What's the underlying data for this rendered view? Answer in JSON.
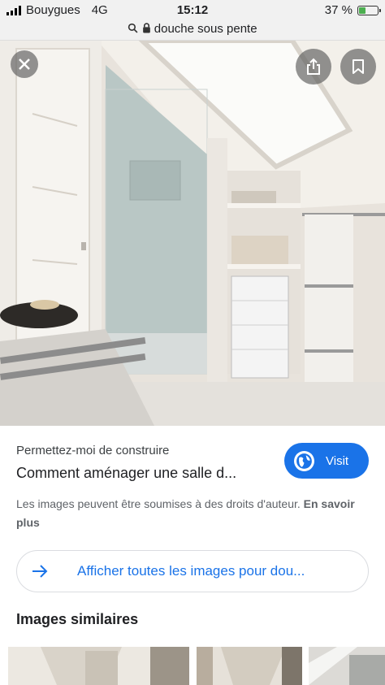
{
  "status_bar": {
    "carrier": "Bouygues",
    "network": "4G",
    "time": "15:12",
    "battery": "37 %",
    "battery_level": 0.37
  },
  "url_bar": {
    "query": "douche sous pente"
  },
  "image_actions": {
    "close_icon": "close-icon",
    "share_icon": "share-icon",
    "bookmark_icon": "bookmark-icon"
  },
  "result": {
    "source": "Permettez-moi de construire",
    "title": "Comment aménager une salle d...",
    "visit_label": "Visit",
    "rights_text": "Les images peuvent être soumises à des droits d'auteur.",
    "rights_link": "En savoir plus"
  },
  "all_images_label": "Afficher toutes les images pour dou...",
  "similar_heading": "Images similaires",
  "colors": {
    "accent": "#1a73e8",
    "text": "#202124",
    "muted": "#5f6368"
  }
}
